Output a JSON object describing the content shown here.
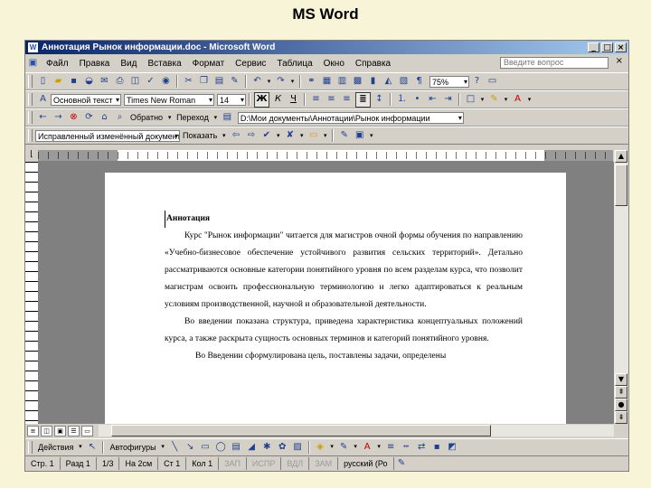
{
  "slide_title": "MS Word",
  "window": {
    "app_icon": "W",
    "title": "Аннотация Рынок информации.doc - Microsoft Word"
  },
  "menu": [
    "Файл",
    "Правка",
    "Вид",
    "Вставка",
    "Формат",
    "Сервис",
    "Таблица",
    "Окно",
    "Справка"
  ],
  "help_box": {
    "placeholder": "Введите вопрос"
  },
  "standard_toolbar": {
    "zoom": "75%"
  },
  "formatting_toolbar": {
    "style": "Основной текст",
    "font": "Times New Roman",
    "size": "14",
    "bold": "Ж",
    "italic": "К",
    "underline": "Ч"
  },
  "web_toolbar": {
    "back_label": "Обратно",
    "forward_label": "Переход",
    "address": "D:\\Мои документы\\Аннотации\\Рынок информации"
  },
  "review_toolbar": {
    "display": "Исправленный изменённый документ",
    "show_label": "Показать"
  },
  "document": {
    "heading": "Аннотация",
    "paragraphs": [
      "Курс \"Рынок информации\" читается для магистров очной формы обучения по направлению «Учебно-бизнесовое обеспечение устойчивого развития сельских территорий». Детально рассматриваются основные категории понятийного уровня по всем разделам курса, что позволит магистрам освоить профессиональную терминологию и легко адаптироваться к реальным условиям производственной, научной и образовательной деятельности.",
      "Во введении показана структура, приведена характеристика концептуальных положений курса, а также раскрыта сущность основных терминов и категорий понятийного уровня.",
      "Во Введении сформулирована цель, поставлены задачи, определены"
    ]
  },
  "draw_toolbar": {
    "actions_label": "Действия",
    "autoshapes_label": "Автофигуры"
  },
  "status": {
    "page": "Стр. 1",
    "section": "Разд 1",
    "pages": "1/3",
    "at": "На 2см",
    "line": "Ст 1",
    "col": "Кол 1",
    "rec": "ЗАП",
    "trk": "ИСПР",
    "ext": "ВДЛ",
    "ovr": "ЗАМ",
    "lang": "русский (Ро"
  }
}
